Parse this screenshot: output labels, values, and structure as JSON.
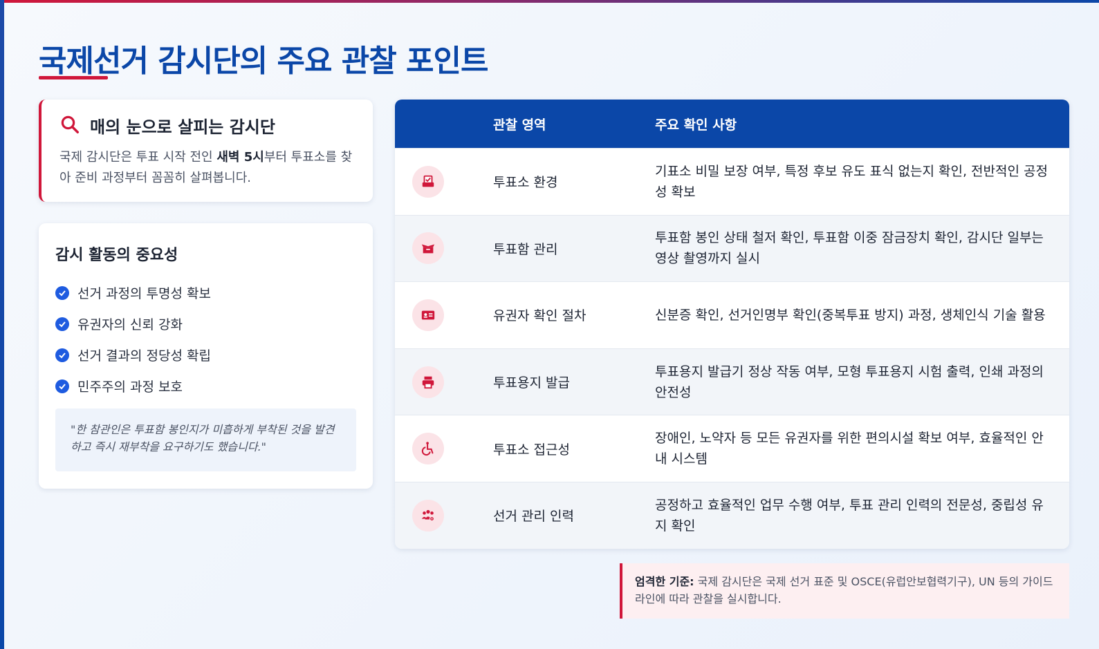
{
  "page": {
    "title": "국제선거 감시단의 주요 관찰 포인트"
  },
  "eye_card": {
    "title": "매의 눈으로 살피는 감시단",
    "body_pre": "국제 감시단은 투표 시작 전인 ",
    "body_bold": "새벽 5시",
    "body_post": "부터 투표소를 찾아 준비 과정부터 꼼꼼히 살펴봅니다."
  },
  "importance": {
    "title": "감시 활동의 중요성",
    "items": [
      "선거 과정의 투명성 확보",
      "유권자의 신뢰 강화",
      "선거 결과의 정당성 확립",
      "민주주의 과정 보호"
    ],
    "quote": "\"한 참관인은 투표함 봉인지가 미흡하게 부착된 것을 발견하고 즉시 재부착을 요구하기도 했습니다.\""
  },
  "table": {
    "headers": [
      "관찰 영역",
      "주요 확인 사항"
    ],
    "rows": [
      {
        "icon": "ballot-check-icon",
        "area": "투표소 환경",
        "detail": "기표소 비밀 보장 여부, 특정 후보 유도 표식 없는지 확인, 전반적인 공정성 확보"
      },
      {
        "icon": "box-open-icon",
        "area": "투표함 관리",
        "detail": "투표함 봉인 상태 철저 확인, 투표함 이중 잠금장치 확인, 감시단 일부는 영상 촬영까지 실시"
      },
      {
        "icon": "id-card-icon",
        "area": "유권자 확인 절차",
        "detail": "신분증 확인, 선거인명부 확인(중복투표 방지) 과정, 생체인식 기술 활용"
      },
      {
        "icon": "printer-icon",
        "area": "투표용지 발급",
        "detail": "투표용지 발급기 정상 작동 여부, 모형 투표용지 시험 출력, 인쇄 과정의 안전성"
      },
      {
        "icon": "wheelchair-icon",
        "area": "투표소 접근성",
        "detail": "장애인, 노약자 등 모든 유권자를 위한 편의시설 확보 여부, 효율적인 안내 시스템"
      },
      {
        "icon": "users-gear-icon",
        "area": "선거 관리 인력",
        "detail": "공정하고 효율적인 업무 수행 여부, 투표 관리 인력의 전문성, 중립성 유지 확인"
      }
    ]
  },
  "notice": {
    "label": "엄격한 기준:",
    "text": " 국제 감시단은 국제 선거 표준 및 OSCE(유럽안보협력기구), UN 등의 가이드라인에 따라 관찰을 실시합니다."
  },
  "colors": {
    "primary": "#0b47a8",
    "accent": "#d0173a",
    "check": "#1e5be0"
  }
}
